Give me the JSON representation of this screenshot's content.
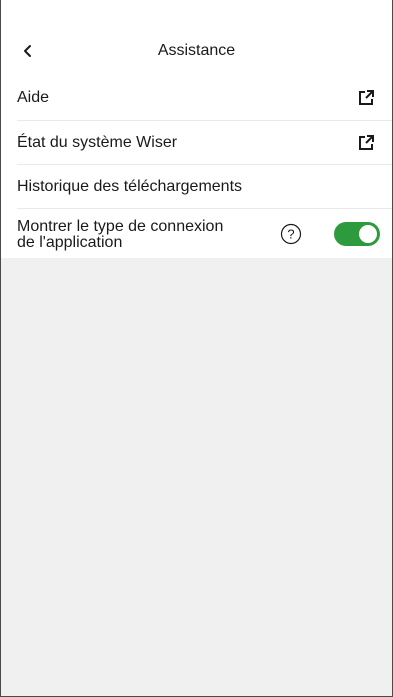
{
  "header": {
    "title": "Assistance",
    "back_icon": "chevron-left-icon"
  },
  "menu": {
    "items": [
      {
        "label": "Aide",
        "icon": "external-link-icon"
      },
      {
        "label": "État du système Wiser",
        "icon": "external-link-icon"
      },
      {
        "label": "Historique des téléchargements"
      }
    ],
    "connection_toggle": {
      "label_line1": "Montrer le type de connexion",
      "label_line2": "de l'application",
      "help_icon": "question-circle-icon",
      "enabled": true
    }
  },
  "colors": {
    "toggle_on": "#2e9a3e",
    "background": "#f0f0f0",
    "surface": "#ffffff"
  }
}
